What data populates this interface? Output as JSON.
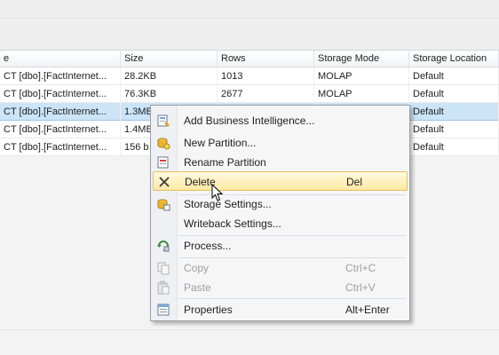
{
  "grid": {
    "columns": [
      "e",
      "Size",
      "Rows",
      "Storage Mode",
      "Storage Location"
    ],
    "rows": [
      {
        "source": "CT [dbo].[FactInternet...",
        "size": "28.2KB",
        "rows": "1013",
        "mode": "MOLAP",
        "location": "Default"
      },
      {
        "source": "CT [dbo].[FactInternet...",
        "size": "76.3KB",
        "rows": "2677",
        "mode": "MOLAP",
        "location": "Default"
      },
      {
        "source": "CT [dbo].[FactInternet...",
        "size": "1.3MB",
        "rows": "",
        "mode": "",
        "location": "Default"
      },
      {
        "source": "CT [dbo].[FactInternet...",
        "size": "1.4MB",
        "rows": "",
        "mode": "",
        "location": "Default"
      },
      {
        "source": "CT [dbo].[FactInternet...",
        "size": "156 b",
        "rows": "",
        "mode": "",
        "location": "Default"
      }
    ]
  },
  "menu": {
    "items": [
      {
        "label": "Add Business Intelligence...",
        "shortcut": "",
        "icon": "business-intelligence-wizard-icon"
      },
      {
        "label": "New Partition...",
        "shortcut": "",
        "icon": "new-partition-icon"
      },
      {
        "label": "Rename Partition",
        "shortcut": "",
        "icon": "rename-icon"
      },
      {
        "label": "Delete",
        "shortcut": "Del",
        "icon": "delete-x-icon"
      },
      {
        "label": "Storage Settings...",
        "shortcut": "",
        "icon": "storage-settings-icon"
      },
      {
        "label": "Writeback Settings...",
        "shortcut": "",
        "icon": ""
      },
      {
        "label": "Process...",
        "shortcut": "",
        "icon": "process-icon"
      },
      {
        "label": "Copy",
        "shortcut": "Ctrl+C",
        "icon": "copy-icon"
      },
      {
        "label": "Paste",
        "shortcut": "Ctrl+V",
        "icon": "paste-icon"
      },
      {
        "label": "Properties",
        "shortcut": "Alt+Enter",
        "icon": "properties-icon"
      }
    ]
  },
  "colors": {
    "selection": "#cce4f7",
    "menu_highlight": "#ffe9a5"
  }
}
